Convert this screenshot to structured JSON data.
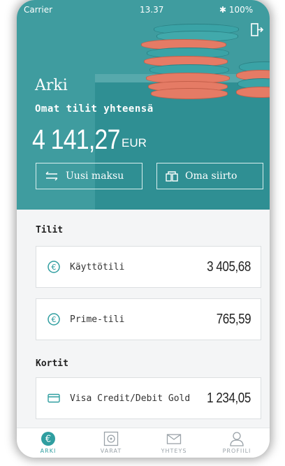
{
  "status_bar": {
    "carrier": "Carrier",
    "time": "13.37",
    "battery": "100%"
  },
  "header": {
    "title": "Arki",
    "subtitle": "Omat tilit yhteensä",
    "total_amount": "4 141,27",
    "currency": "EUR",
    "logout_icon": "logout-icon"
  },
  "actions": [
    {
      "label": "Uusi maksu",
      "icon": "transfer-arrows-icon"
    },
    {
      "label": "Oma siirto",
      "icon": "own-transfer-icon"
    }
  ],
  "accounts_section": {
    "heading": "Tilit",
    "items": [
      {
        "name": "Käyttötili",
        "amount": "3 405,68",
        "icon": "euro-icon"
      },
      {
        "name": "Prime-tili",
        "amount": "765,59",
        "icon": "euro-icon"
      }
    ]
  },
  "cards_section": {
    "heading": "Kortit",
    "items": [
      {
        "name": "Visa Credit/Debit Gold",
        "amount": "1 234,05",
        "icon": "credit-card-icon"
      }
    ]
  },
  "tabbar": [
    {
      "label": "ARKI",
      "icon": "euro-icon",
      "active": true
    },
    {
      "label": "VARAT",
      "icon": "safe-icon",
      "active": false
    },
    {
      "label": "YHTEYS",
      "icon": "mail-icon",
      "active": false
    },
    {
      "label": "PROFIILI",
      "icon": "profile-icon",
      "active": false
    }
  ],
  "colors": {
    "accent": "#3f9c9f",
    "coral": "#e57b65",
    "teal_dark": "#2f8f93"
  }
}
